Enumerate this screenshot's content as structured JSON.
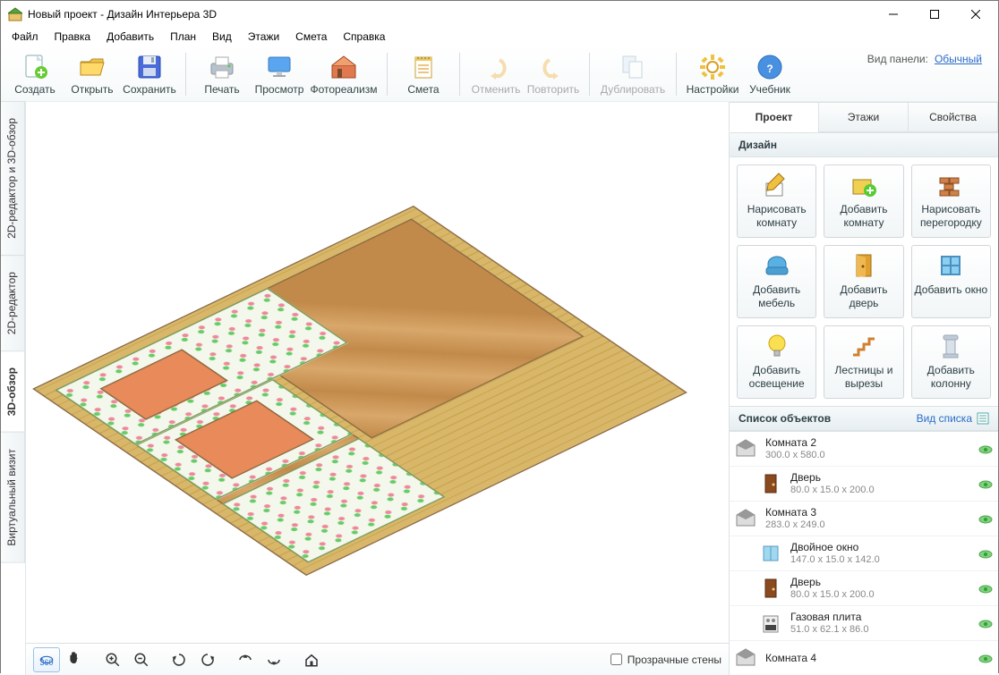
{
  "window": {
    "title": "Новый проект - Дизайн Интерьера 3D"
  },
  "menu": [
    "Файл",
    "Правка",
    "Добавить",
    "План",
    "Вид",
    "Этажи",
    "Смета",
    "Справка"
  ],
  "toolbar": {
    "create": "Создать",
    "open": "Открыть",
    "save": "Сохранить",
    "print": "Печать",
    "preview": "Просмотр",
    "photoreal": "Фотореализм",
    "estimate": "Смета",
    "undo": "Отменить",
    "redo": "Повторить",
    "duplicate": "Дублировать",
    "settings": "Настройки",
    "help": "Учебник"
  },
  "panel_mode": {
    "label": "Вид панели:",
    "value": "Обычный"
  },
  "vtabs": {
    "both": "2D-редактор и 3D-обзор",
    "editor2d": "2D-редактор",
    "view3d": "3D-обзор",
    "virtual": "Виртуальный визит"
  },
  "bottom": {
    "transparent_walls": "Прозрачные стены"
  },
  "right_tabs": {
    "project": "Проект",
    "floors": "Этажи",
    "props": "Свойства"
  },
  "design": {
    "header": "Дизайн",
    "draw_room": "Нарисовать комнату",
    "add_room": "Добавить комнату",
    "draw_partition": "Нарисовать перегородку",
    "add_furniture": "Добавить мебель",
    "add_door": "Добавить дверь",
    "add_window": "Добавить окно",
    "add_light": "Добавить освещение",
    "stairs": "Лестницы и вырезы",
    "add_column": "Добавить колонну"
  },
  "objects": {
    "header": "Список объектов",
    "list_view": "Вид списка",
    "items": [
      {
        "name": "Комната 2",
        "dim": "300.0 x 580.0",
        "type": "room",
        "indent": 0
      },
      {
        "name": "Дверь",
        "dim": "80.0 x 15.0 x 200.0",
        "type": "door",
        "indent": 1
      },
      {
        "name": "Комната 3",
        "dim": "283.0 x 249.0",
        "type": "room",
        "indent": 0
      },
      {
        "name": "Двойное окно",
        "dim": "147.0 x 15.0 x 142.0",
        "type": "window",
        "indent": 1
      },
      {
        "name": "Дверь",
        "dim": "80.0 x 15.0 x 200.0",
        "type": "door",
        "indent": 1
      },
      {
        "name": "Газовая плита",
        "dim": "51.0 x 62.1 x 86.0",
        "type": "stove",
        "indent": 1
      },
      {
        "name": "Комната 4",
        "dim": "",
        "type": "room",
        "indent": 0
      }
    ]
  }
}
